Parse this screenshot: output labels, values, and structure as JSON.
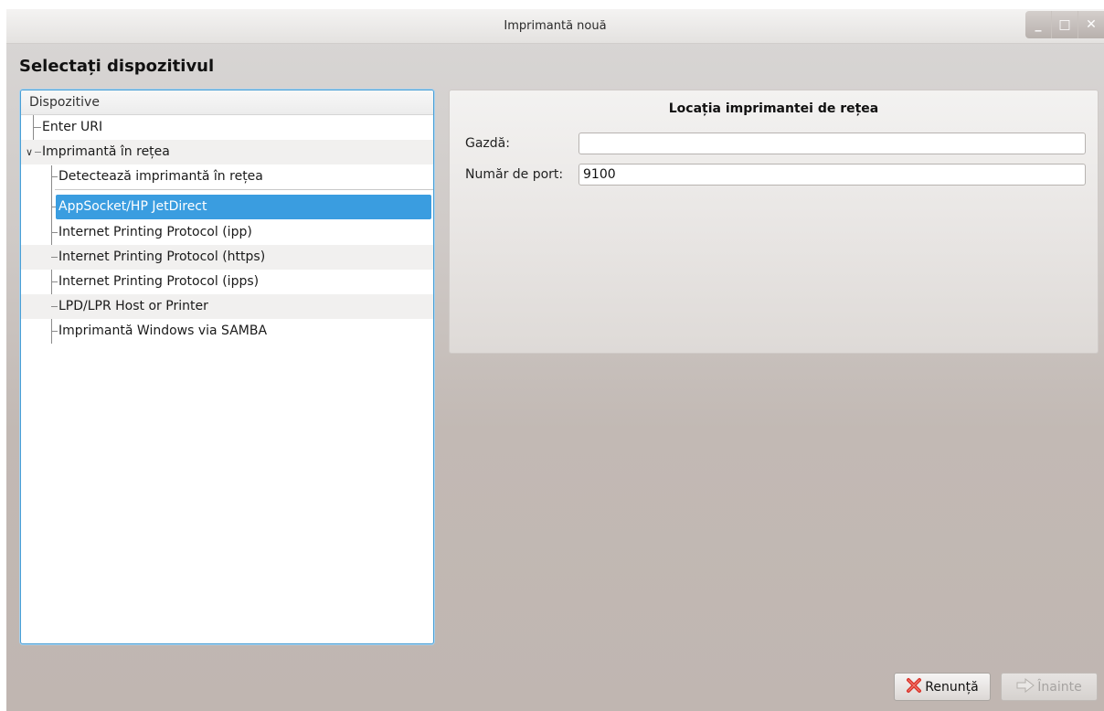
{
  "window": {
    "title": "Imprimantă nouă",
    "controls": {
      "minimize": "_",
      "maximize": "□",
      "close": "✕"
    }
  },
  "page_heading": "Selectați dispozitivul",
  "device_tree": {
    "header": "Dispozitive",
    "items": [
      {
        "label": "Enter URI"
      },
      {
        "label": "Imprimantă în rețea",
        "expanded": true
      },
      {
        "label": "Detectează imprimantă în rețea"
      },
      {
        "label": "AppSocket/HP JetDirect",
        "selected": true
      },
      {
        "label": "Internet Printing Protocol (ipp)"
      },
      {
        "label": "Internet Printing Protocol (https)"
      },
      {
        "label": "Internet Printing Protocol (ipps)"
      },
      {
        "label": "LPD/LPR Host or Printer"
      },
      {
        "label": "Imprimantă Windows via SAMBA"
      }
    ]
  },
  "location_panel": {
    "title": "Locația imprimantei de rețea",
    "host": {
      "label": "Gazdă:",
      "value": ""
    },
    "port": {
      "label": "Număr de port:",
      "value": "9100"
    }
  },
  "buttons": {
    "cancel": {
      "label": "Renunță",
      "icon": "cancel-x-icon"
    },
    "forward": {
      "label": "Înainte",
      "icon": "forward-arrow-icon",
      "enabled": false
    }
  },
  "colors": {
    "selection": "#3a9de0",
    "focus_border": "#4a9fd5",
    "cancel_icon": "#d9342b"
  }
}
